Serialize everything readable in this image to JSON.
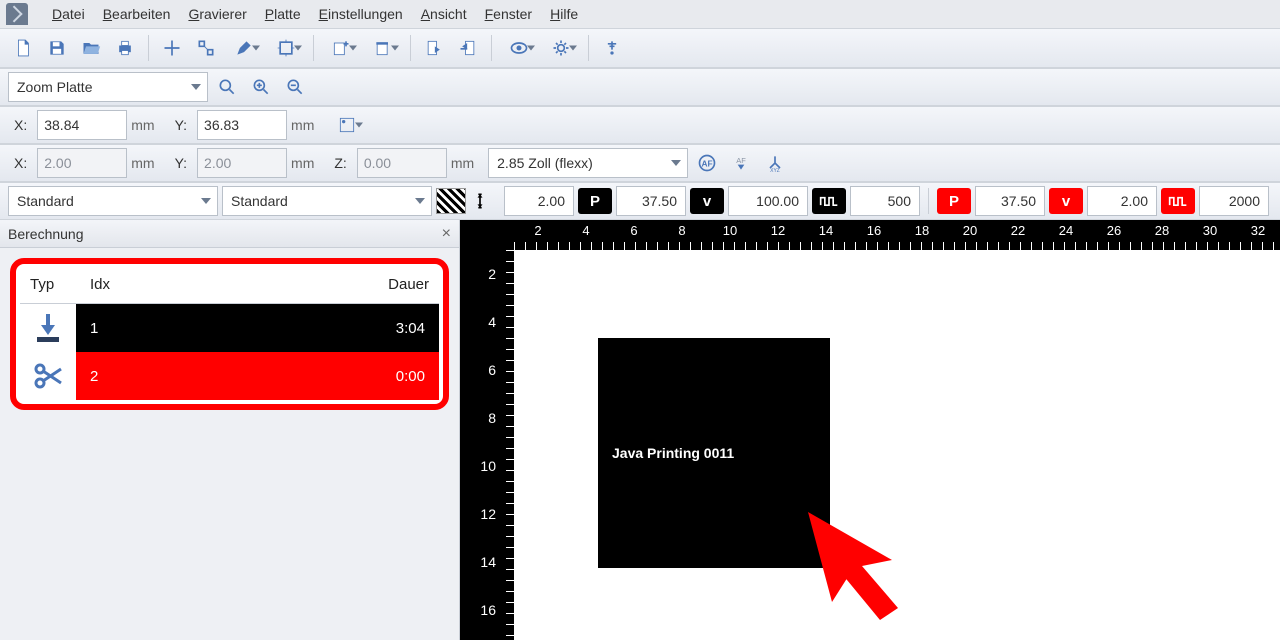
{
  "menu": {
    "items": [
      "Datei",
      "Bearbeiten",
      "Gravierer",
      "Platte",
      "Einstellungen",
      "Ansicht",
      "Fenster",
      "Hilfe"
    ]
  },
  "zoom_combo": "Zoom Platte",
  "coords1": {
    "x_label": "X:",
    "x": "38.84",
    "x_unit": "mm",
    "y_label": "Y:",
    "y": "36.83",
    "y_unit": "mm"
  },
  "coords2": {
    "x_label": "X:",
    "x": "2.00",
    "x_unit": "mm",
    "y_label": "Y:",
    "y": "2.00",
    "y_unit": "mm",
    "z_label": "Z:",
    "z": "0.00",
    "z_unit": "mm",
    "lens": "2.85 Zoll (flexx)"
  },
  "std1": "Standard",
  "std2": "Standard",
  "params": {
    "hatch": "2.00",
    "p1": "37.50",
    "v1": "100.00",
    "f1": "500",
    "p2": "37.50",
    "v2": "2.00",
    "f2": "2000"
  },
  "panel": {
    "title": "Berechnung",
    "headers": {
      "typ": "Typ",
      "idx": "Idx",
      "dauer": "Dauer"
    },
    "rows": [
      {
        "kind": "engrave",
        "idx": "1",
        "dauer": "3:04",
        "color": "black"
      },
      {
        "kind": "cut",
        "idx": "2",
        "dauer": "0:00",
        "color": "red"
      }
    ]
  },
  "canvas": {
    "text": "Java Printing 0011",
    "h_ticks": [
      "2",
      "4",
      "6",
      "8",
      "10",
      "12",
      "14",
      "16",
      "18",
      "20",
      "22",
      "24",
      "26",
      "28",
      "30",
      "32"
    ],
    "v_ticks": [
      "2",
      "4",
      "6",
      "8",
      "10",
      "12",
      "14",
      "16"
    ]
  }
}
